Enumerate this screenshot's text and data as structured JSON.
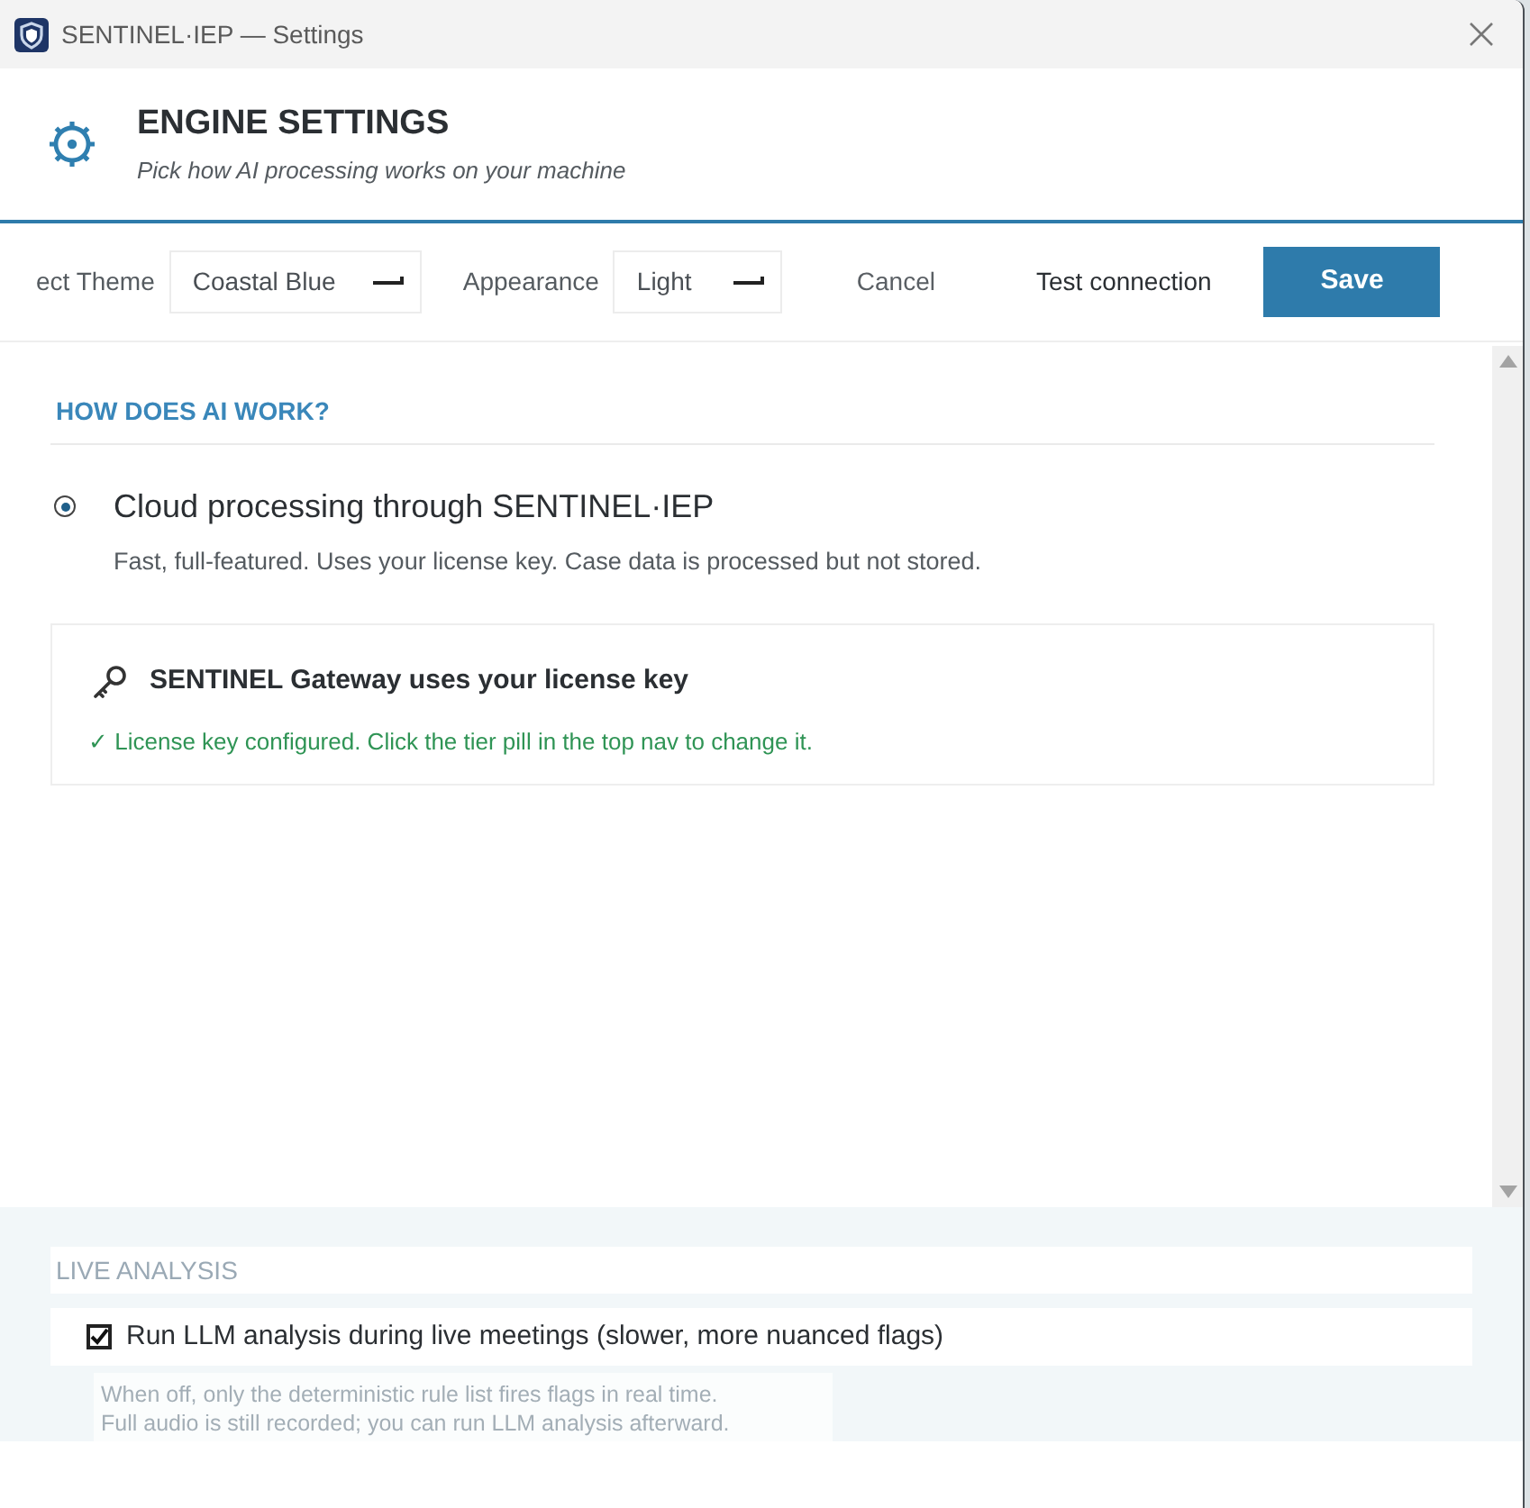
{
  "window": {
    "title": "SENTINEL·IEP — Settings"
  },
  "header": {
    "title": "ENGINE SETTINGS",
    "subtitle": "Pick how AI processing works on your machine"
  },
  "toolbar": {
    "fields": [
      {
        "label": "ect Theme",
        "value": "Coastal Blue"
      },
      {
        "label": "Appearance",
        "value": "Light"
      }
    ],
    "buttons": [
      {
        "label": "Cancel",
        "kind": "ghost"
      },
      {
        "label": "Test connection",
        "kind": "text"
      },
      {
        "label": "Save",
        "kind": "primary"
      }
    ]
  },
  "ai_section": {
    "heading": "HOW DOES AI WORK?",
    "options": [
      {
        "label": "Cloud processing through SENTINEL·IEP",
        "description": "Fast, full-featured. Uses your license key. Case data is processed but not stored.",
        "selected": true
      }
    ],
    "card": {
      "title": "SENTINEL Gateway uses your license key",
      "status": "✓ License key configured. Click the tier pill in the top nav to change it."
    }
  },
  "live_analysis": {
    "heading": "LIVE ANALYSIS",
    "options": [
      {
        "label": "Run LLM analysis during live meetings (slower, more nuanced flags)",
        "checked": true,
        "help": [
          "When off, only the deterministic rule list fires flags in real time.",
          "Full audio is still recorded; you can run LLM analysis afterward."
        ]
      }
    ]
  }
}
